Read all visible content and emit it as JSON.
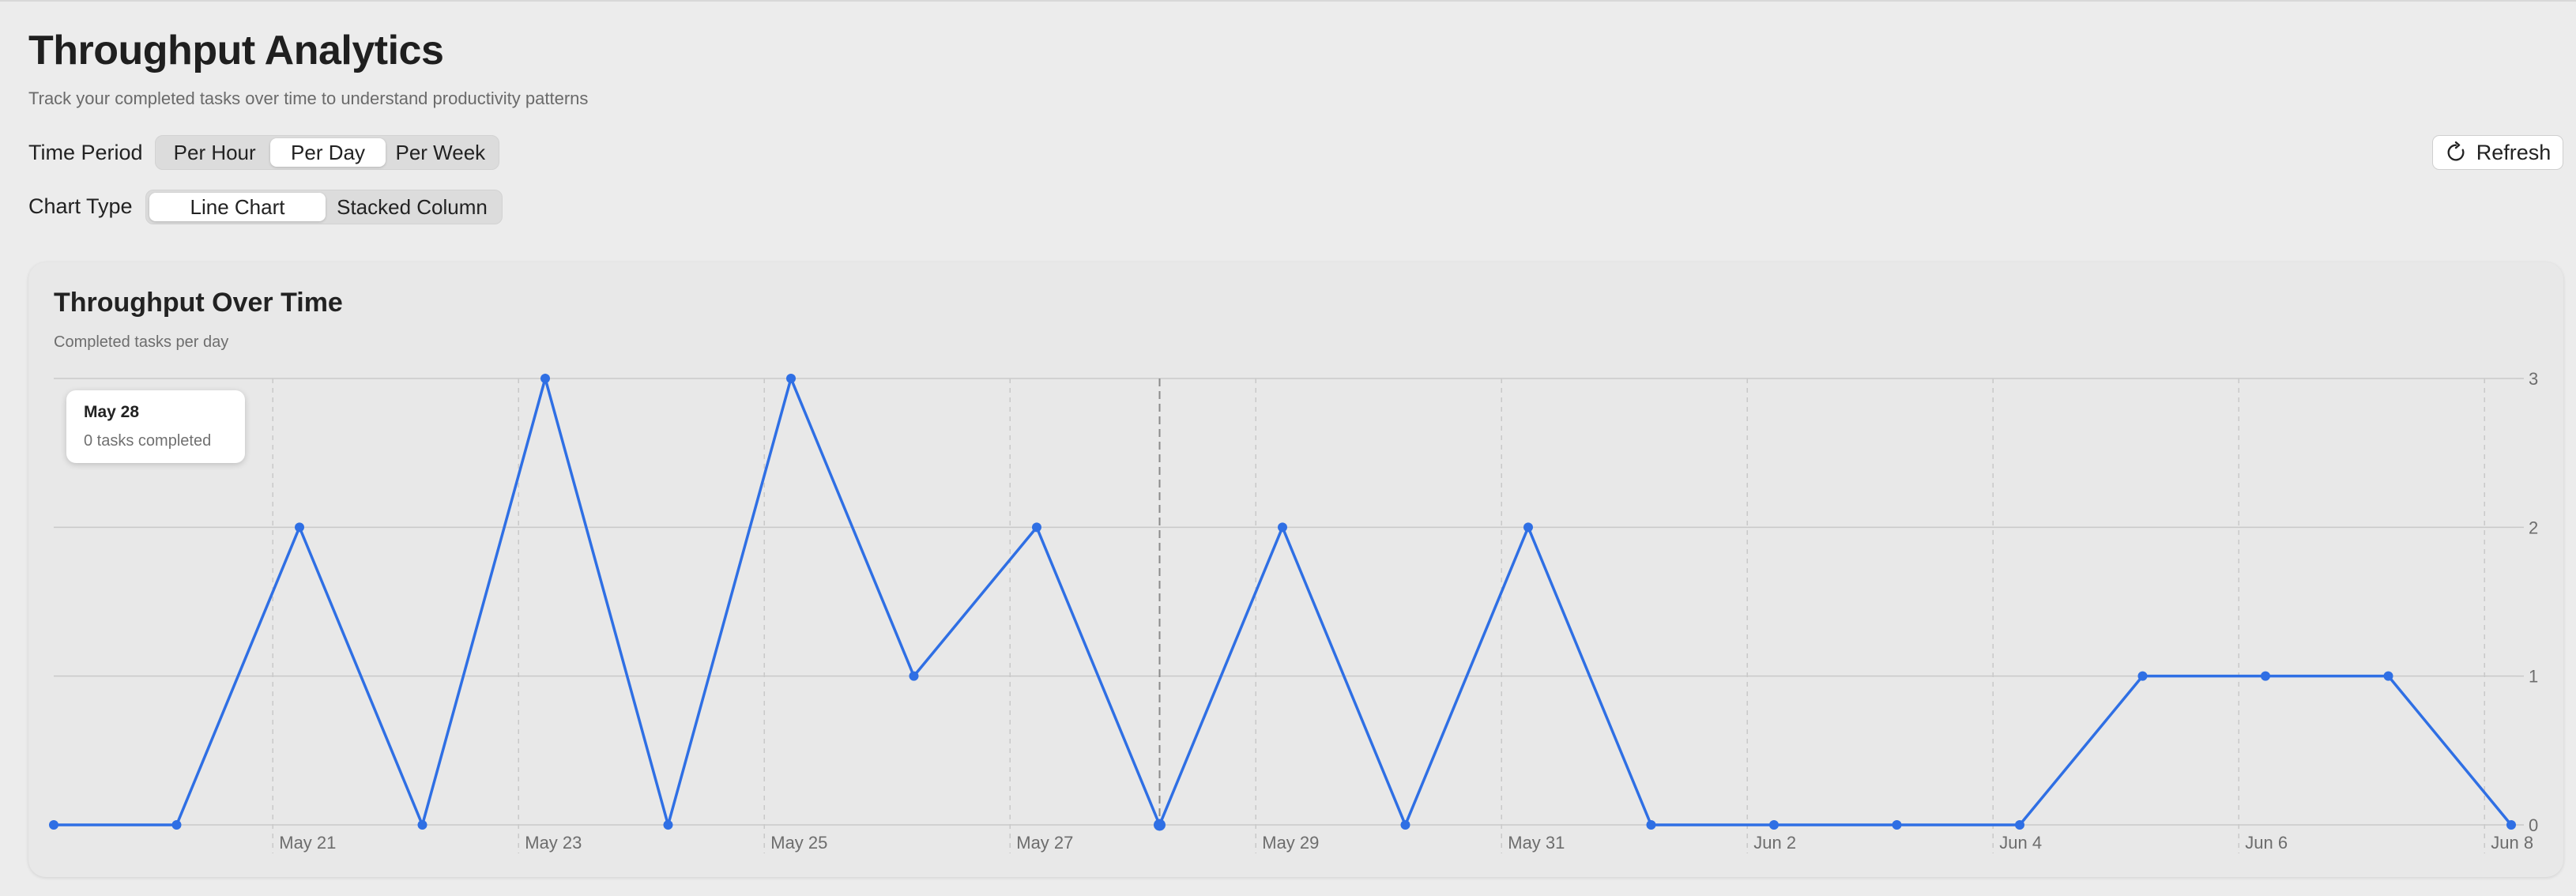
{
  "header": {
    "title": "Throughput Analytics",
    "subtitle": "Track your completed tasks over time to understand productivity patterns"
  },
  "controls": {
    "time_period": {
      "label": "Time Period",
      "options": [
        "Per Hour",
        "Per Day",
        "Per Week"
      ],
      "selected": "Per Day"
    },
    "chart_type": {
      "label": "Chart Type",
      "options": [
        "Line Chart",
        "Stacked Column"
      ],
      "selected": "Line Chart"
    },
    "refresh_label": "Refresh"
  },
  "card": {
    "title": "Throughput Over Time",
    "subtitle": "Completed tasks per day"
  },
  "tooltip": {
    "date": "May 28",
    "value": "0 tasks completed"
  },
  "colors": {
    "line": "#2f6fe4",
    "grid": "#c9c9c9",
    "axis_text": "#6d6d6d",
    "hover_rule": "#8a8a8a"
  },
  "icons": {
    "refresh": "refresh-icon"
  },
  "chart_data": {
    "type": "line",
    "title": "Throughput Over Time",
    "subtitle": "Completed tasks per day",
    "x": [
      "May 19",
      "May 20",
      "May 21",
      "May 22",
      "May 23",
      "May 24",
      "May 25",
      "May 26",
      "May 27",
      "May 28",
      "May 29",
      "May 30",
      "May 31",
      "Jun 1",
      "Jun 2",
      "Jun 3",
      "Jun 4",
      "Jun 5",
      "Jun 6",
      "Jun 7",
      "Jun 8"
    ],
    "values": [
      0,
      0,
      2,
      0,
      3,
      0,
      3,
      1,
      2,
      0,
      2,
      0,
      2,
      0,
      0,
      0,
      0,
      1,
      1,
      1,
      0
    ],
    "x_tick_labels": [
      "May 21",
      "May 23",
      "May 25",
      "May 27",
      "May 29",
      "May 31",
      "Jun 2",
      "Jun 4",
      "Jun 6",
      "Jun 8"
    ],
    "y_ticks": [
      0,
      1,
      2,
      3
    ],
    "ylim": [
      0,
      3
    ],
    "y_axis_position": "right",
    "grid": true,
    "highlighted": "May 28"
  }
}
